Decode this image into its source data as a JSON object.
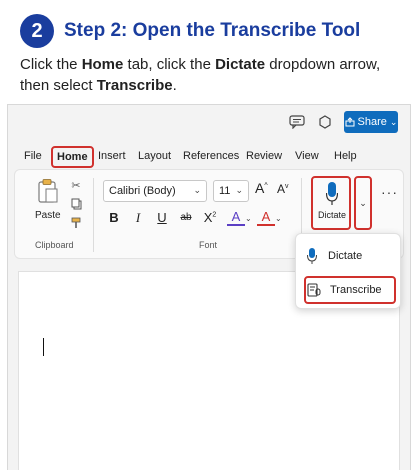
{
  "step": {
    "number": "2",
    "title": "Step 2: Open the Transcribe Tool"
  },
  "instruction": {
    "part1": "Click the ",
    "home": "Home",
    "part2": " tab, click the ",
    "dictate": "Dictate",
    "part3": " dropdown arrow, then select ",
    "transcribe": "Transcribe",
    "part4": "."
  },
  "topbar": {
    "share_label": "Share",
    "share_caret": "⌄"
  },
  "menu": {
    "items": [
      "File",
      "Home",
      "Insert",
      "Layout",
      "References",
      "Review",
      "View",
      "Help"
    ]
  },
  "ribbon": {
    "paste_label": "Paste",
    "clipboard_label": "Clipboard",
    "font_label": "Font",
    "font_name": "Calibri (Body)",
    "font_size": "11",
    "bold": "B",
    "italic": "I",
    "underline": "U",
    "strikethrough": "ab",
    "superscript": "X",
    "font_color": "A",
    "grow_font": "A",
    "shrink_font": "A",
    "dictate_label": "Dictate",
    "more": "···"
  },
  "dictate_menu": {
    "items": [
      {
        "label": "Dictate",
        "icon": "mic-icon"
      },
      {
        "label": "Transcribe",
        "icon": "transcribe-icon"
      }
    ]
  },
  "colors": {
    "accent": "#1a3d9e",
    "highlight": "#d0312d",
    "share": "#0f6cbd",
    "mic": "#0f6cbd"
  }
}
